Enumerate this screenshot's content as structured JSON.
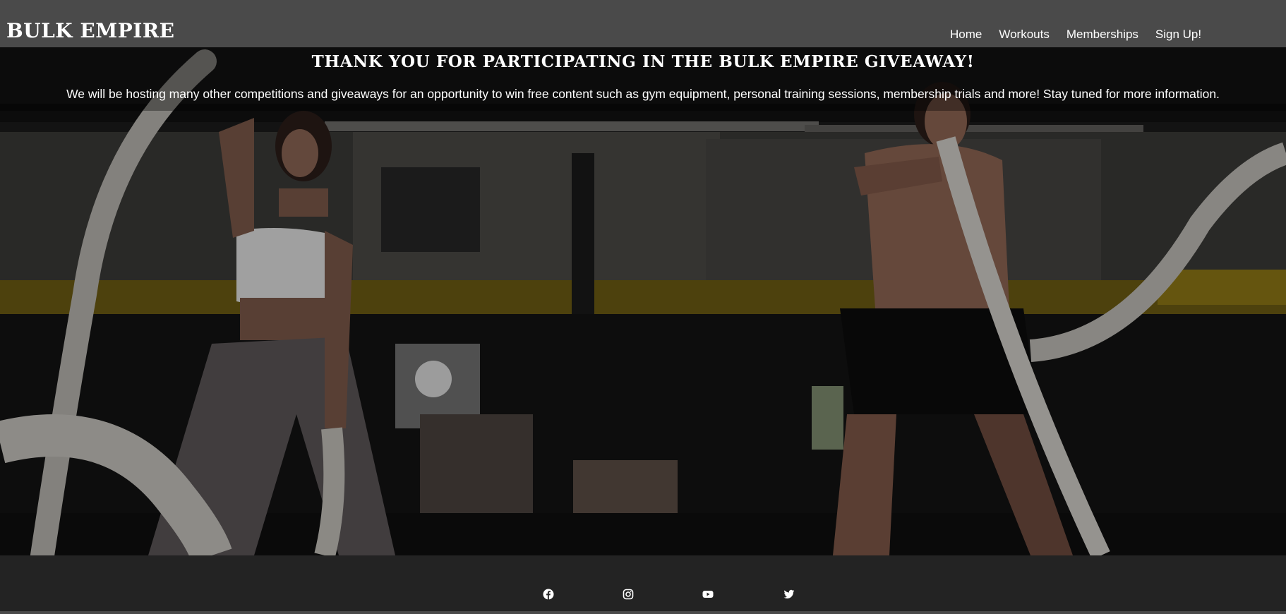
{
  "brand": "BULK EMPIRE",
  "nav": {
    "items": [
      "Home",
      "Workouts",
      "Memberships",
      "Sign Up!"
    ]
  },
  "hero": {
    "title": "THANK YOU FOR PARTICIPATING IN THE BULK EMPIRE GIVEAWAY!",
    "text": "We will be hosting many other competitions and giveaways for an opportunity to win free content such as gym equipment, personal training sessions, membership trials and more! Stay tuned for more information.",
    "background_image": "gym-battle-ropes-photo"
  },
  "footer": {
    "social_icons": [
      "facebook-icon",
      "instagram-icon",
      "youtube-icon",
      "twitter-icon"
    ]
  },
  "colors": {
    "header_bg": "#4a4a4a",
    "footer_bg": "#232323",
    "text": "#ffffff"
  }
}
